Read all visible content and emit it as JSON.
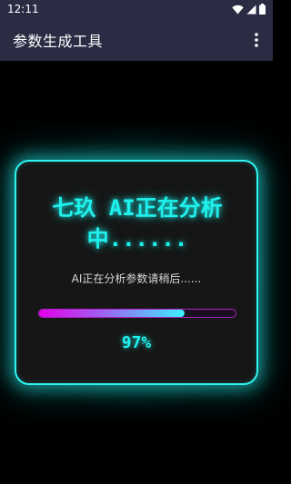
{
  "status_bar": {
    "time": "12:11"
  },
  "app_bar": {
    "title": "参数生成工具"
  },
  "card": {
    "title": "七玖 AI正在分析中......",
    "subtitle": "AI正在分析参数请稍后......",
    "progress": {
      "value_text": "97%",
      "fraction": 0.74
    }
  },
  "colors": {
    "accent": "#1ff2ee",
    "bar_bg": "#2b2c44"
  }
}
